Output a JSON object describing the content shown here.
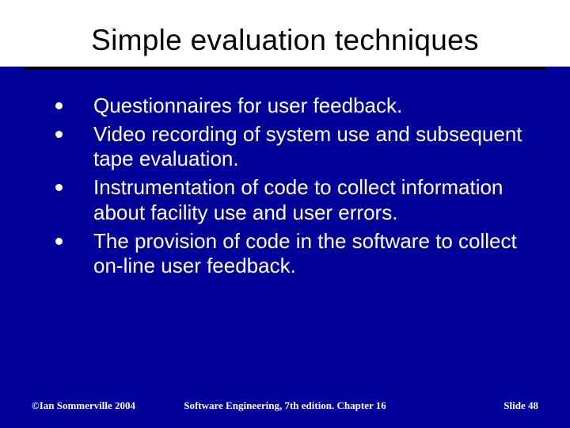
{
  "title": "Simple evaluation techniques",
  "bullets": [
    "Questionnaires for user feedback.",
    "Video recording of system use and subsequent tape evaluation.",
    "Instrumentation of code to collect information about facility use and user errors.",
    "The provision of code in the software to collect on-line user feedback."
  ],
  "footer": {
    "left": "©Ian Sommerville 2004",
    "center": "Software Engineering, 7th edition. Chapter 16",
    "right": "Slide 48"
  }
}
